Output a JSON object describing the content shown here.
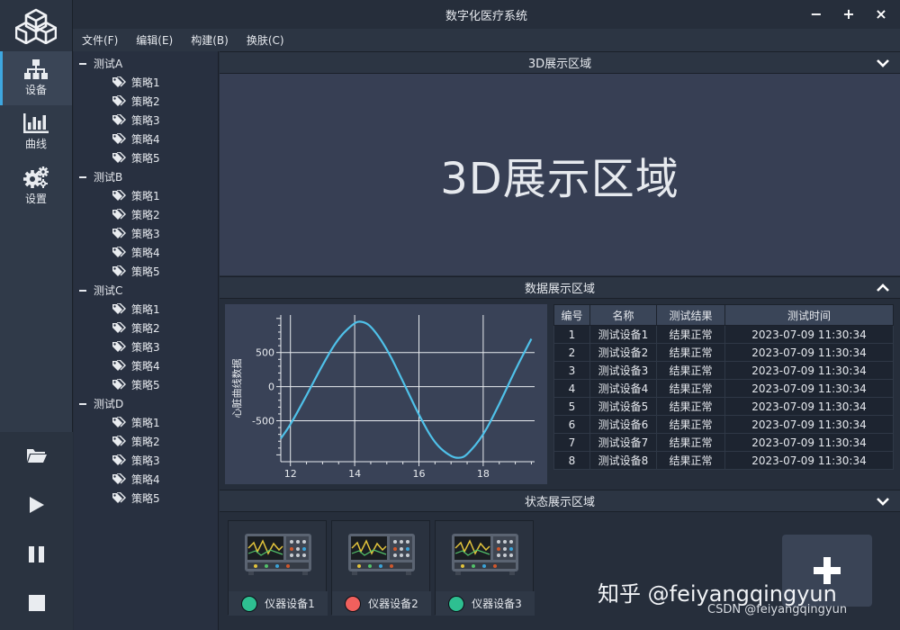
{
  "window": {
    "title": "数字化医疗系统",
    "controls": [
      "−",
      "+",
      "×"
    ]
  },
  "menu": [
    {
      "label": "文件(F)"
    },
    {
      "label": "编辑(E)"
    },
    {
      "label": "构建(B)"
    },
    {
      "label": "换肤(C)"
    }
  ],
  "nav": [
    {
      "label": "设备",
      "icon": "sitemap-icon",
      "active": true
    },
    {
      "label": "曲线",
      "icon": "bar-chart-icon",
      "active": false
    },
    {
      "label": "设置",
      "icon": "gears-icon",
      "active": false
    }
  ],
  "tools": [
    "folder-open-icon",
    "play-icon",
    "pause-icon",
    "stop-icon"
  ],
  "tree": [
    {
      "label": "测试A",
      "children": [
        "策略1",
        "策略2",
        "策略3",
        "策略4",
        "策略5"
      ]
    },
    {
      "label": "测试B",
      "children": [
        "策略1",
        "策略2",
        "策略3",
        "策略4",
        "策略5"
      ]
    },
    {
      "label": "测试C",
      "children": [
        "策略1",
        "策略2",
        "策略3",
        "策略4",
        "策略5"
      ]
    },
    {
      "label": "测试D",
      "children": [
        "策略1",
        "策略2",
        "策略3",
        "策略4",
        "策略5"
      ]
    }
  ],
  "panels": {
    "display3d": {
      "header": "3D展示区域",
      "content": "3D展示区域",
      "chevron": "chevron-down-icon"
    },
    "data": {
      "header": "数据展示区域",
      "chevron": "chevron-up-icon"
    },
    "status": {
      "header": "状态展示区域",
      "chevron": "chevron-down-icon"
    }
  },
  "chart_data": {
    "type": "line",
    "ylabel": "心脏曲线数据",
    "xlabel": "",
    "xlim": [
      11.7,
      19.6
    ],
    "ylim": [
      -1100,
      1050
    ],
    "xticks": [
      12,
      14,
      16,
      18
    ],
    "yticks": [
      500,
      0,
      -500
    ],
    "grid": true,
    "series": [
      {
        "color": "#4fc1e9",
        "x": [
          11.7,
          12.0,
          12.5,
          13.0,
          13.5,
          14.0,
          14.2,
          14.5,
          15.0,
          15.5,
          16.0,
          16.5,
          17.0,
          17.3,
          17.5,
          18.0,
          18.5,
          19.0,
          19.5
        ],
        "y": [
          -760,
          -560,
          -130,
          320,
          720,
          940,
          960,
          900,
          560,
          80,
          -420,
          -840,
          -1030,
          -1050,
          -1000,
          -720,
          -260,
          250,
          700
        ]
      }
    ]
  },
  "table": {
    "headers": [
      "编号",
      "名称",
      "测试结果",
      "测试时间"
    ],
    "rows": [
      [
        "1",
        "测试设备1",
        "结果正常",
        "2023-07-09 11:30:34"
      ],
      [
        "2",
        "测试设备2",
        "结果正常",
        "2023-07-09 11:30:34"
      ],
      [
        "3",
        "测试设备3",
        "结果正常",
        "2023-07-09 11:30:34"
      ],
      [
        "4",
        "测试设备4",
        "结果正常",
        "2023-07-09 11:30:34"
      ],
      [
        "5",
        "测试设备5",
        "结果正常",
        "2023-07-09 11:30:34"
      ],
      [
        "6",
        "测试设备6",
        "结果正常",
        "2023-07-09 11:30:34"
      ],
      [
        "7",
        "测试设备7",
        "结果正常",
        "2023-07-09 11:30:34"
      ],
      [
        "8",
        "测试设备8",
        "结果正常",
        "2023-07-09 11:30:34"
      ]
    ]
  },
  "devices": [
    {
      "label": "仪器设备1",
      "status_color": "#2ebf91"
    },
    {
      "label": "仪器设备2",
      "status_color": "#f0605d"
    },
    {
      "label": "仪器设备3",
      "status_color": "#2ebf91"
    }
  ],
  "add_button": {
    "icon": "plus-icon"
  },
  "watermark": {
    "main": "知乎 @feiyangqingyun",
    "sub": "CSDN @feiyangqingyun"
  }
}
